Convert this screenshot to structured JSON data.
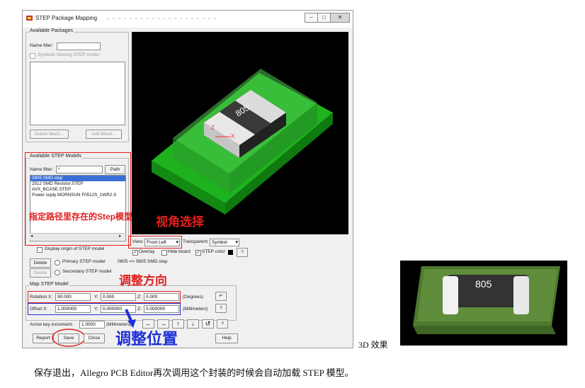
{
  "window": {
    "title": "STEP Package Mapping",
    "btn_minimize": "–",
    "btn_maximize": "□",
    "btn_close": "✕"
  },
  "available_packages": {
    "legend": "Available Packages",
    "name_filter_label": "Name filter:",
    "name_filter_value": "",
    "symbols_missing_label": "Symbols missing STEP model",
    "delete_mech_label": "Delete Mech...",
    "add_mech_label": "Add Mech..."
  },
  "step_models": {
    "legend": "Available STEP Models",
    "name_filter_label": "Name filter:",
    "name_filter_value": "*",
    "path_label": "Path",
    "items": [
      "0805 SMD.step",
      "2512 SMD Resistor.STEP",
      "AVX_BCASE.STEP",
      "Power suply MORNSUN F0512S_1WR2.S"
    ],
    "scroll_left": "◂",
    "scroll_right": "▸",
    "display_origin_label": "Display origin of STEP model"
  },
  "view_controls": {
    "view_label": "View:",
    "view_value": "Front Left",
    "transparent_label": "Transparent:",
    "transparent_value": "Symbol",
    "overlay_label": "Overlay",
    "hide_board_label": "Hide board",
    "step_color_label": "STEP color",
    "help_q": "?",
    "dropdown_arrow": "▾"
  },
  "model_select": {
    "delete_label": "Delete",
    "primary_label": "Primary STEP model",
    "secondary_label": "Secondary STEP model",
    "mapping_text": "0805 => 0805 SMD.step"
  },
  "map_step_model": {
    "legend": "Map STEP Model",
    "rotation_label": "Rotation X:",
    "rotation_x": "90.000",
    "rotation_y_label": "Y:",
    "rotation_y": "0.000",
    "rotation_z_label": "Z:",
    "rotation_z": "0.000",
    "degrees_label": "(Degrees)",
    "offset_label": "Offset X:",
    "offset_x": "1.000000",
    "offset_y_label": "Y:",
    "offset_y": "0.000000",
    "offset_z_label": "Z:",
    "offset_z": "0.000000",
    "millimeters_label": "(Millimeters)",
    "rotate_icon_glyph": "↶",
    "help_q": "?"
  },
  "arrow_key": {
    "label": "Arrow key increment:",
    "value": "1.0000",
    "unit": "(Millimeters)",
    "arrows": [
      "←",
      "→",
      "↑",
      "↓",
      "↺"
    ],
    "help_q": "?"
  },
  "footer_buttons": {
    "report": "Report",
    "save": "Save",
    "close": "Close",
    "help": "Help"
  },
  "viewport": {
    "component_label": "805",
    "axis_z": "Z",
    "axis_x": "X"
  },
  "annotations": {
    "step_path_note": "指定路径里存在的Step模型",
    "view_note": "视角选择",
    "direction_note": "调整方向",
    "position_note": "调整位置",
    "effect_3d_label": "3D 效果"
  },
  "preview": {
    "component_label": "805"
  },
  "caption": "保存退出，Allegro PCB Editor再次调用这个封装的时候会自动加载 STEP 模型。",
  "colors": {
    "annotation_red": "#e02020",
    "annotation_blue": "#1c2fd6",
    "viewport_bg": "#000000",
    "board_green": "#2bd42b"
  }
}
